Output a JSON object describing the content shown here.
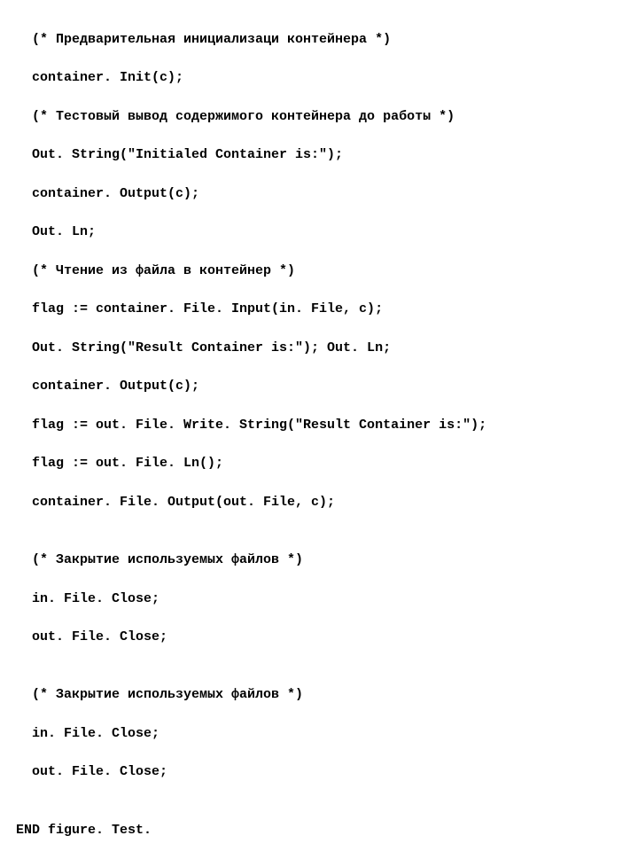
{
  "code": {
    "l01": "(* Предварительная инициализаци контейнера *)",
    "l02": "container. Init(c);",
    "l03": "(* Тестовый вывод содержимого контейнера до работы *)",
    "l04": "Out. String(\"Initialed Container is:\");",
    "l05": "container. Output(c);",
    "l06": "Out. Ln;",
    "l07": "(* Чтение из файла в контейнер *)",
    "l08": "flag := container. File. Input(in. File, c);",
    "l09": "Out. String(\"Result Container is:\"); Out. Ln;",
    "l10": "container. Output(c);",
    "l11": "flag := out. File. Write. String(\"Result Container is:\");",
    "l12": "flag := out. File. Ln();",
    "l13": "container. File. Output(out. File, c);",
    "l14": "",
    "l15": "(* Закрытие используемых файлов *)",
    "l16": "in. File. Close;",
    "l17": "out. File. Close;",
    "l18": "",
    "l19": "(* Закрытие используемых файлов *)",
    "l20": "in. File. Close;",
    "l21": "out. File. Close;",
    "l22": "",
    "l23": "END figure. Test."
  }
}
